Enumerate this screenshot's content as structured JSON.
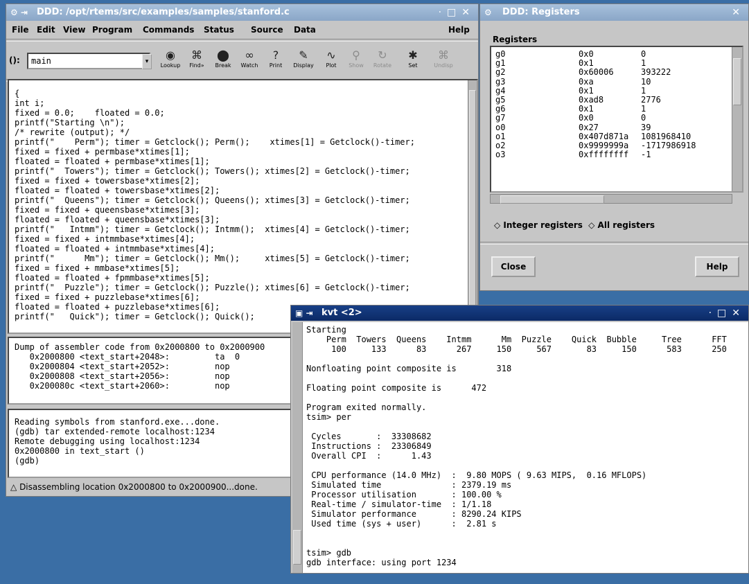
{
  "ddd": {
    "title": "DDD: /opt/rtems/src/examples/samples/stanford.c",
    "menu": [
      "File",
      "Edit",
      "View",
      "Program",
      "Commands",
      "Status",
      "Source",
      "Data"
    ],
    "help": "Help",
    "arg_label": "():",
    "arg_value": "main",
    "toolbar": [
      {
        "label": "Lookup",
        "icon": "lookup-icon",
        "glyph": "◉",
        "enabled": true
      },
      {
        "label": "Find»",
        "icon": "find-icon",
        "glyph": "⌘",
        "enabled": true
      },
      {
        "label": "Break",
        "icon": "break-icon",
        "glyph": "⬤",
        "enabled": true
      },
      {
        "label": "Watch",
        "icon": "watch-icon",
        "glyph": "∞",
        "enabled": true
      },
      {
        "label": "Print",
        "icon": "print-icon",
        "glyph": "?",
        "enabled": true
      },
      {
        "label": "Display",
        "icon": "display-icon",
        "glyph": "✎",
        "enabled": true
      },
      {
        "label": "Plot",
        "icon": "plot-icon",
        "glyph": "∿",
        "enabled": true
      },
      {
        "label": "Show",
        "icon": "show-icon",
        "glyph": "⚲",
        "enabled": false
      },
      {
        "label": "Rotate",
        "icon": "rotate-icon",
        "glyph": "↻",
        "enabled": false
      },
      {
        "label": "Set",
        "icon": "set-icon",
        "glyph": "✱",
        "enabled": true
      },
      {
        "label": "Undisp",
        "icon": "undisp-icon",
        "glyph": "⌘",
        "enabled": false
      }
    ],
    "source_lines": [
      "{",
      "int i;",
      "fixed = 0.0;    floated = 0.0;",
      "printf(\"Starting \\n\");",
      "/* rewrite (output); */",
      "printf(\"    Perm\"); timer = Getclock(); Perm();    xtimes[1] = Getclock()-timer;",
      "fixed = fixed + permbase*xtimes[1];",
      "floated = floated + permbase*xtimes[1];",
      "printf(\"  Towers\"); timer = Getclock(); Towers(); xtimes[2] = Getclock()-timer;",
      "fixed = fixed + towersbase*xtimes[2];",
      "floated = floated + towersbase*xtimes[2];",
      "printf(\"  Queens\"); timer = Getclock(); Queens(); xtimes[3] = Getclock()-timer;",
      "fixed = fixed + queensbase*xtimes[3];",
      "floated = floated + queensbase*xtimes[3];",
      "printf(\"   Intmm\"); timer = Getclock(); Intmm();  xtimes[4] = Getclock()-timer;",
      "fixed = fixed + intmmbase*xtimes[4];",
      "floated = floated + intmmbase*xtimes[4];",
      "printf(\"      Mm\"); timer = Getclock(); Mm();     xtimes[5] = Getclock()-timer;",
      "fixed = fixed + mmbase*xtimes[5];",
      "floated = floated + fpmmbase*xtimes[5];",
      "printf(\"  Puzzle\"); timer = Getclock(); Puzzle(); xtimes[6] = Getclock()-timer;",
      "fixed = fixed + puzzlebase*xtimes[6];",
      "floated = floated + puzzlebase*xtimes[6];",
      "printf(\"   Quick\"); timer = Getclock(); Quick();"
    ],
    "asm_lines": [
      "Dump of assembler code from 0x2000800 to 0x2000900",
      "   0x2000800 <text_start+2048>:         ta  0",
      "   0x2000804 <text_start+2052>:         nop",
      "   0x2000808 <text_start+2056>:         nop",
      "   0x200080c <text_start+2060>:         nop"
    ],
    "console_lines": [
      "Reading symbols from stanford.exe...done.",
      "(gdb) tar extended-remote localhost:1234",
      "Remote debugging using localhost:1234",
      "0x2000800 in text_start ()",
      "(gdb) "
    ],
    "status": "Disassembling location 0x2000800 to 0x2000900...done."
  },
  "regs": {
    "title": "DDD: Registers",
    "heading": "Registers",
    "rows": [
      {
        "name": "g0",
        "hex": "0x0",
        "dec": "0"
      },
      {
        "name": "g1",
        "hex": "0x1",
        "dec": "1"
      },
      {
        "name": "g2",
        "hex": "0x60006",
        "dec": "393222"
      },
      {
        "name": "g3",
        "hex": "0xa",
        "dec": "10"
      },
      {
        "name": "g4",
        "hex": "0x1",
        "dec": "1"
      },
      {
        "name": "g5",
        "hex": "0xad8",
        "dec": "2776"
      },
      {
        "name": "g6",
        "hex": "0x1",
        "dec": "1"
      },
      {
        "name": "g7",
        "hex": "0x0",
        "dec": "0"
      },
      {
        "name": "o0",
        "hex": "0x27",
        "dec": "39"
      },
      {
        "name": "o1",
        "hex": "0x407d871a",
        "dec": "1081968410"
      },
      {
        "name": "o2",
        "hex": "0x9999999a",
        "dec": "-1717986918"
      },
      {
        "name": "o3",
        "hex": "0xffffffff",
        "dec": "-1"
      }
    ],
    "opt_integer": "Integer registers",
    "opt_all": "All registers",
    "close": "Close",
    "help": "Help"
  },
  "kvt": {
    "title": "kvt <2>",
    "lines": [
      "Starting",
      "    Perm  Towers  Queens    Intmm      Mm  Puzzle    Quick  Bubble     Tree      FFT",
      "     100     133      83      267     150     567       83     150      583      250",
      "",
      "Nonfloating point composite is        318",
      "",
      "Floating point composite is      472",
      "",
      "Program exited normally.",
      "tsim> per",
      "",
      " Cycles       :  33308682",
      " Instructions :  23306849",
      " Overall CPI  :      1.43",
      "",
      " CPU performance (14.0 MHz)  :  9.80 MOPS ( 9.63 MIPS,  0.16 MFLOPS)",
      " Simulated time              : 2379.19 ms",
      " Processor utilisation       : 100.00 %",
      " Real-time / simulator-time  : 1/1.18",
      " Simulator performance       : 8290.24 KIPS",
      " Used time (sys + user)      :  2.81 s",
      "",
      "",
      "tsim> gdb",
      "gdb interface: using port 1234"
    ]
  }
}
